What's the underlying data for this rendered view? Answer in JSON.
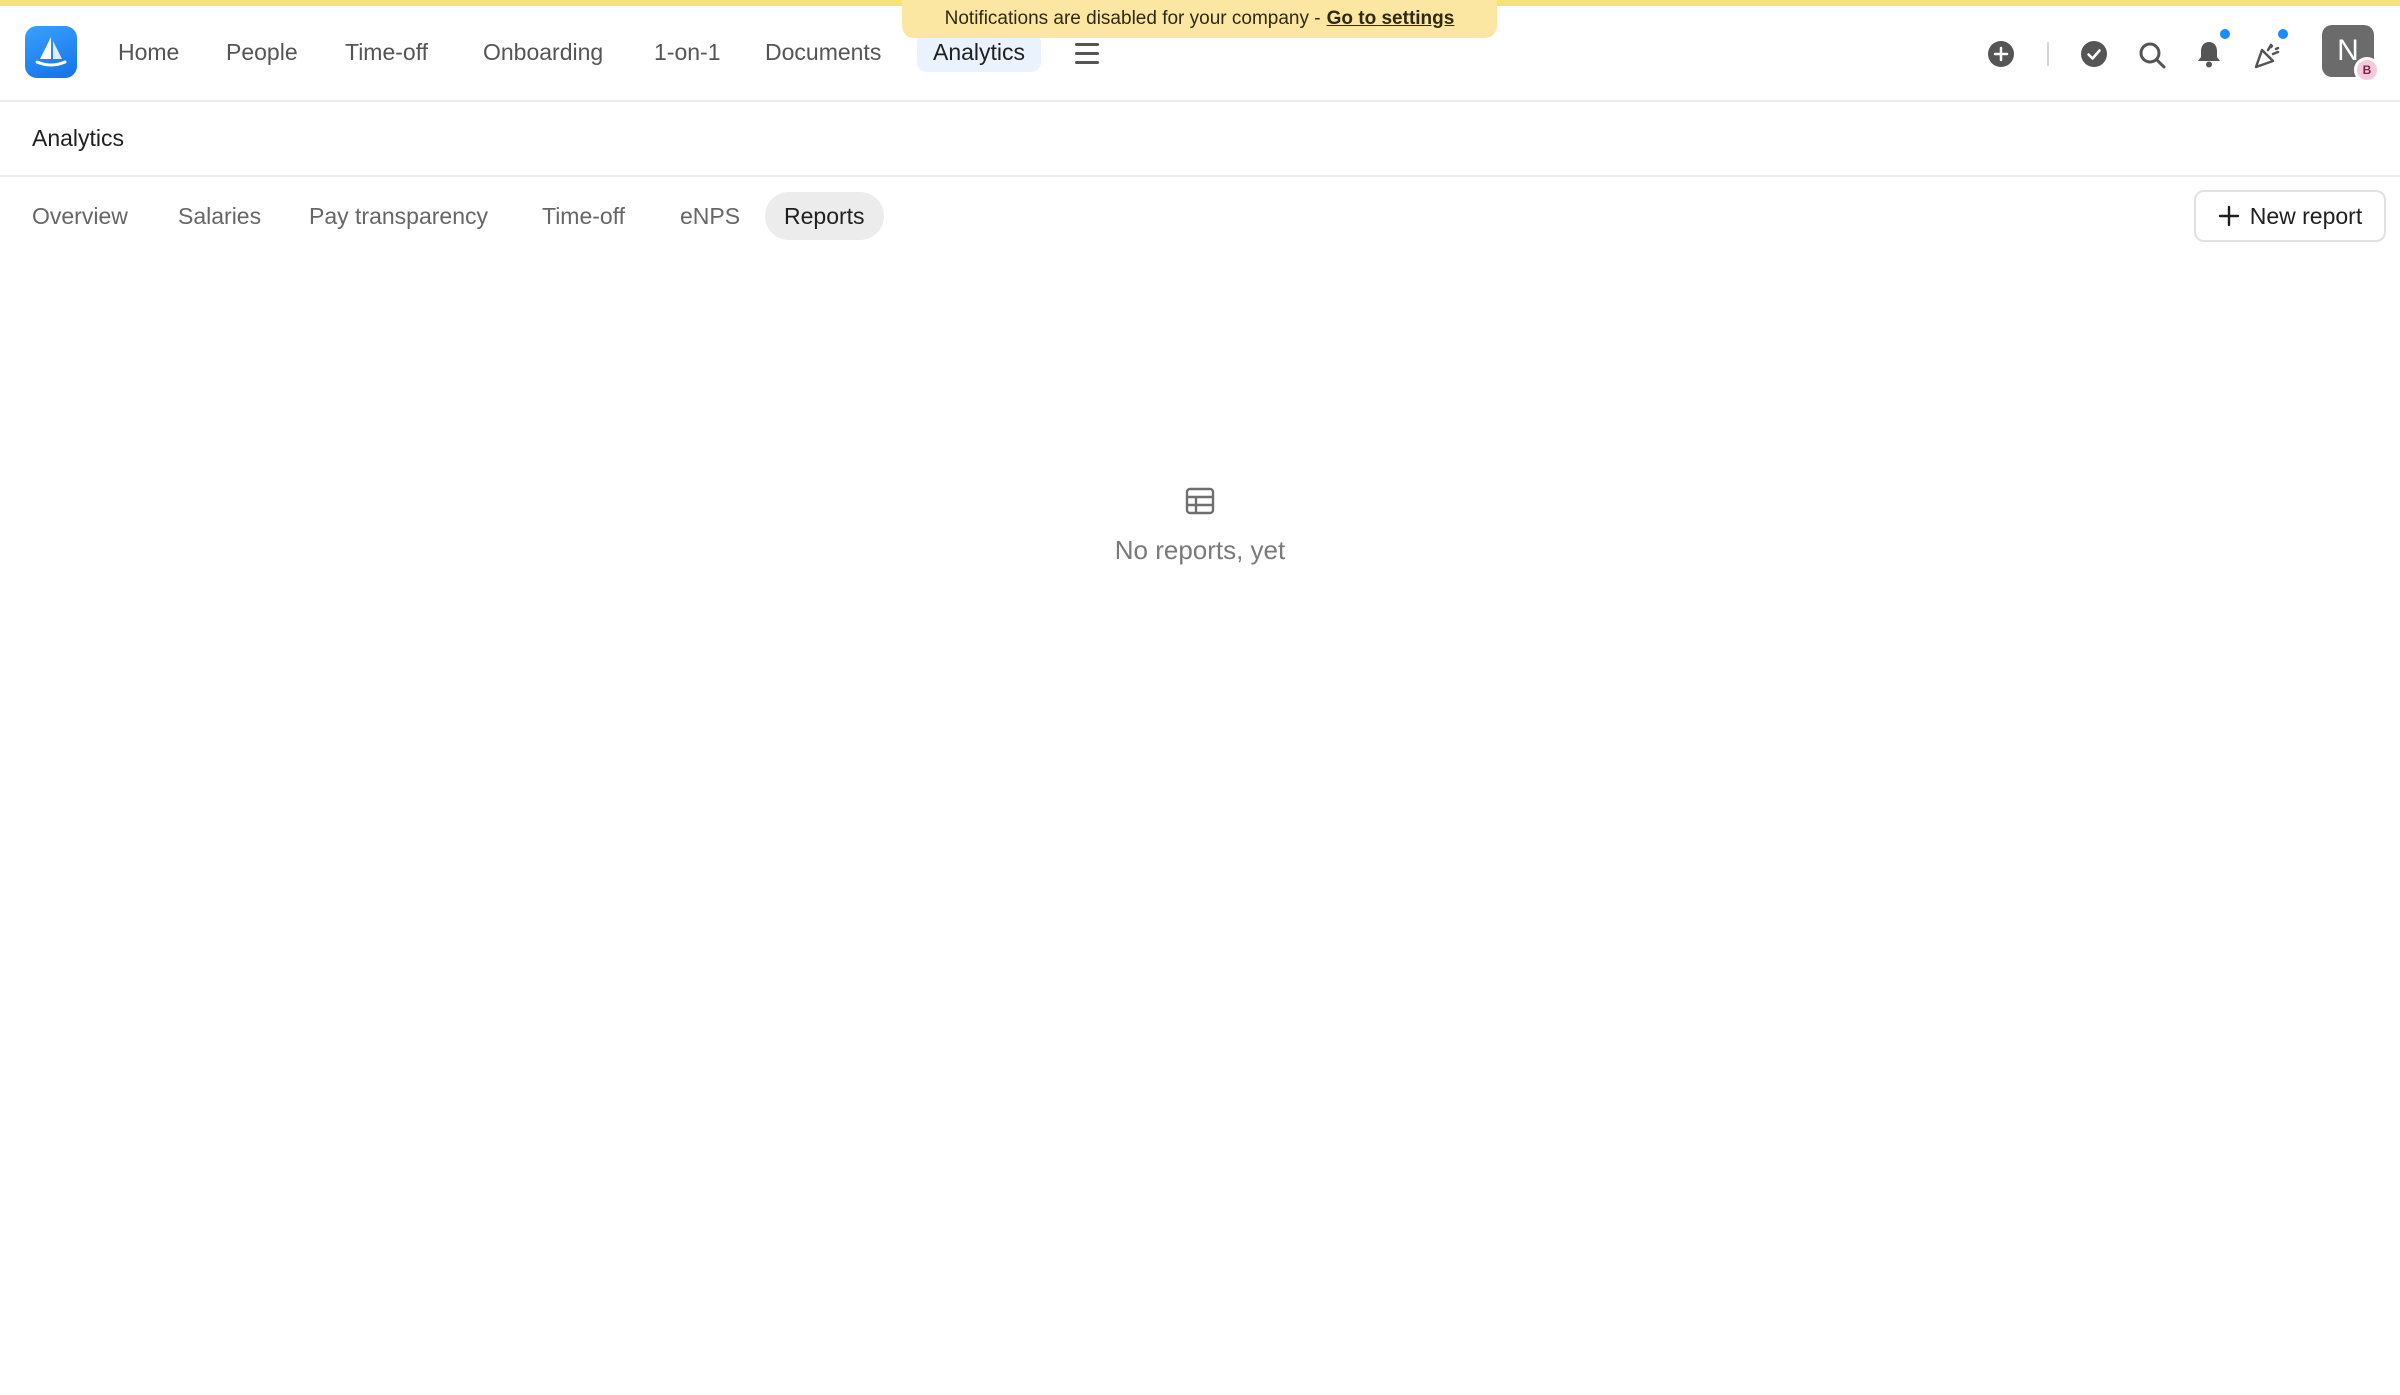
{
  "banner": {
    "text": "Notifications are disabled for your company -",
    "link": "Go to settings"
  },
  "nav": {
    "items": [
      {
        "label": "Home"
      },
      {
        "label": "People"
      },
      {
        "label": "Time-off"
      },
      {
        "label": "Onboarding"
      },
      {
        "label": "1-on-1"
      },
      {
        "label": "Documents"
      },
      {
        "label": "Analytics",
        "active": true
      }
    ],
    "icons": [
      "logo-icon",
      "menu-icon",
      "add-icon",
      "check-icon",
      "search-icon",
      "bell-icon",
      "party-icon"
    ]
  },
  "user": {
    "initial": "N",
    "badge": "B"
  },
  "page": {
    "title": "Analytics"
  },
  "tabs": [
    {
      "label": "Overview"
    },
    {
      "label": "Salaries"
    },
    {
      "label": "Pay transparency"
    },
    {
      "label": "Time-off"
    },
    {
      "label": "eNPS"
    },
    {
      "label": "Reports",
      "active": true
    }
  ],
  "actions": {
    "new_report": "New report"
  },
  "empty": {
    "text": "No reports, yet"
  },
  "colors": {
    "accent": "#1a8cff",
    "banner": "#fbe7a1",
    "active_nav": "#eaf3fd"
  }
}
